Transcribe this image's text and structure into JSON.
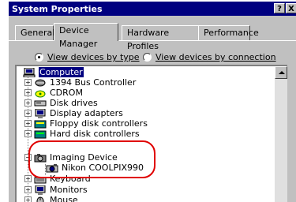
{
  "window": {
    "title": "System Properties",
    "help_button": "?",
    "close_button": "X"
  },
  "tabs": [
    "General",
    "Device Manager",
    "Hardware Profiles",
    "Performance"
  ],
  "view_options": {
    "by_type": "View devices by type",
    "by_connection": "View devices by connection"
  },
  "tree": {
    "root": "Computer",
    "items": [
      "1394 Bus Controller",
      "CDROM",
      "Disk drives",
      "Display adapters",
      "Floppy disk controllers",
      "Hard disk controllers",
      "Imaging Device",
      "Nikon COOLPIX990",
      "Keyboard",
      "Monitors",
      "Mouse"
    ]
  },
  "colors": {
    "accent": "#000080",
    "highlight": "#e00000"
  }
}
